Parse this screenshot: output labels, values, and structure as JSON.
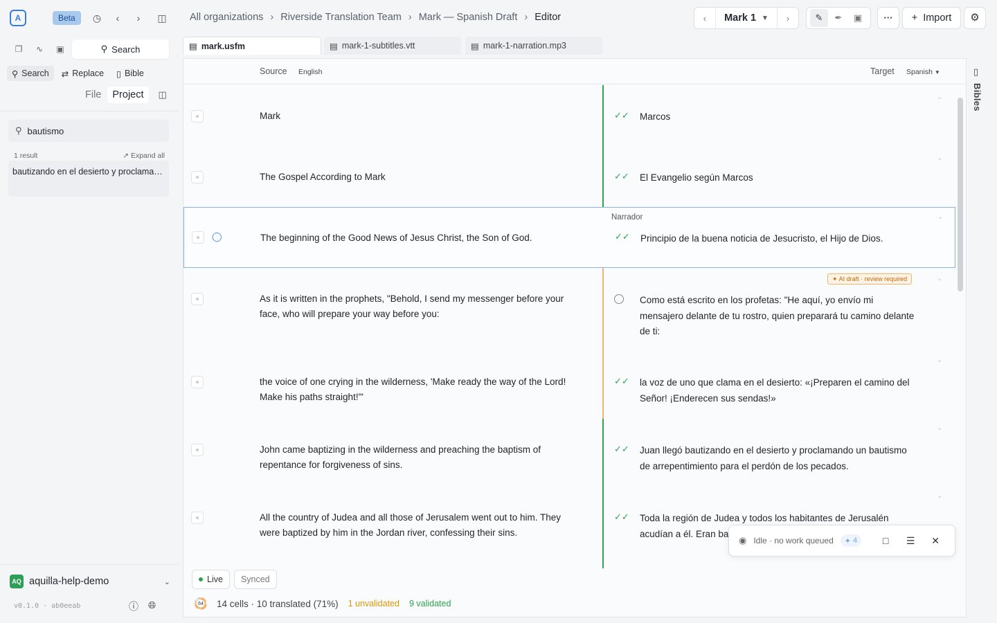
{
  "app": {
    "logo_glyph": "A",
    "beta_label": "Beta"
  },
  "breadcrumb": [
    "All organizations",
    "Riverside Translation Team",
    "Mark — Spanish Draft",
    "Editor"
  ],
  "chapter": {
    "label": "Mark 1"
  },
  "toolbar": {
    "more_label": "···",
    "import_label": "Import"
  },
  "sidebar": {
    "search_tab": "Search",
    "subtabs": [
      "Search",
      "Replace",
      "Bible"
    ],
    "scope": [
      "File",
      "Project"
    ],
    "search_value": "bautismo",
    "result_count": "1 result",
    "expand_all": "Expand all",
    "result_snippet": "bautizando en el desierto y proclaman...",
    "workspace_badge": "AQ",
    "workspace_name": "aquilla-help-demo",
    "version": "v0.1.0 · ab0eeab"
  },
  "files": [
    "mark.usfm",
    "mark-1-subtitles.vtt",
    "mark-1-narration.mp3"
  ],
  "editor": {
    "source_label": "Source",
    "source_lang": "English",
    "target_label": "Target",
    "target_lang": "Spanish",
    "rows": [
      {
        "source": "Mark",
        "target": "Marcos",
        "status": "validated"
      },
      {
        "source": "The Gospel According to Mark",
        "target": "El Evangelio según Marcos",
        "status": "validated"
      },
      {
        "source": "The beginning of the Good News of Jesus Christ, the Son of God.",
        "target": "Principio de la buena noticia de Jesucristo, el Hijo de Dios.",
        "status": "validated",
        "speaker": "Narrador"
      },
      {
        "source": "As it is written in the prophets, \"Behold, I send my messenger before your face, who will prepare your way before you:",
        "target": "Como está escrito en los profetas: \"He aquí, yo envío mi mensajero delante de tu rostro, quien preparará tu camino delante de ti:",
        "status": "pending",
        "badge": "AI draft · review required"
      },
      {
        "source": "the voice of one crying in the wilderness, 'Make ready the way of the Lord! Make his paths straight!'\"",
        "target": "la voz de uno que clama en el desierto: «¡Preparen el camino del Señor! ¡Enderecen sus sendas!»",
        "status": "validated"
      },
      {
        "source": "John came baptizing in the wilderness and preaching the baptism of repentance for forgiveness of sins.",
        "target": "Juan llegó bautizando en el desierto y proclamando un bautismo de arrepentimiento para el perdón de los pecados.",
        "status": "validated"
      },
      {
        "source": "All the country of Judea and all those of Jerusalem went out to him. They were baptized by him in the Jordan river, confessing their sins.",
        "target": "Toda la región de Judea y todos los habitantes de Jerusalén acudían a él. Eran ba confesando sus pec",
        "status": "validated"
      }
    ],
    "live_label": "Live",
    "synced_label": "Synced",
    "progress_ring": "64",
    "progress_fraction": 0.71,
    "stats_text": "14 cells · 10 translated (71%)",
    "unvalidated": "1 unvalidated",
    "validated": "9 validated"
  },
  "worker": {
    "status": "Idle · no work queued",
    "count": "4"
  },
  "right_rail": {
    "label": "Bibles"
  }
}
